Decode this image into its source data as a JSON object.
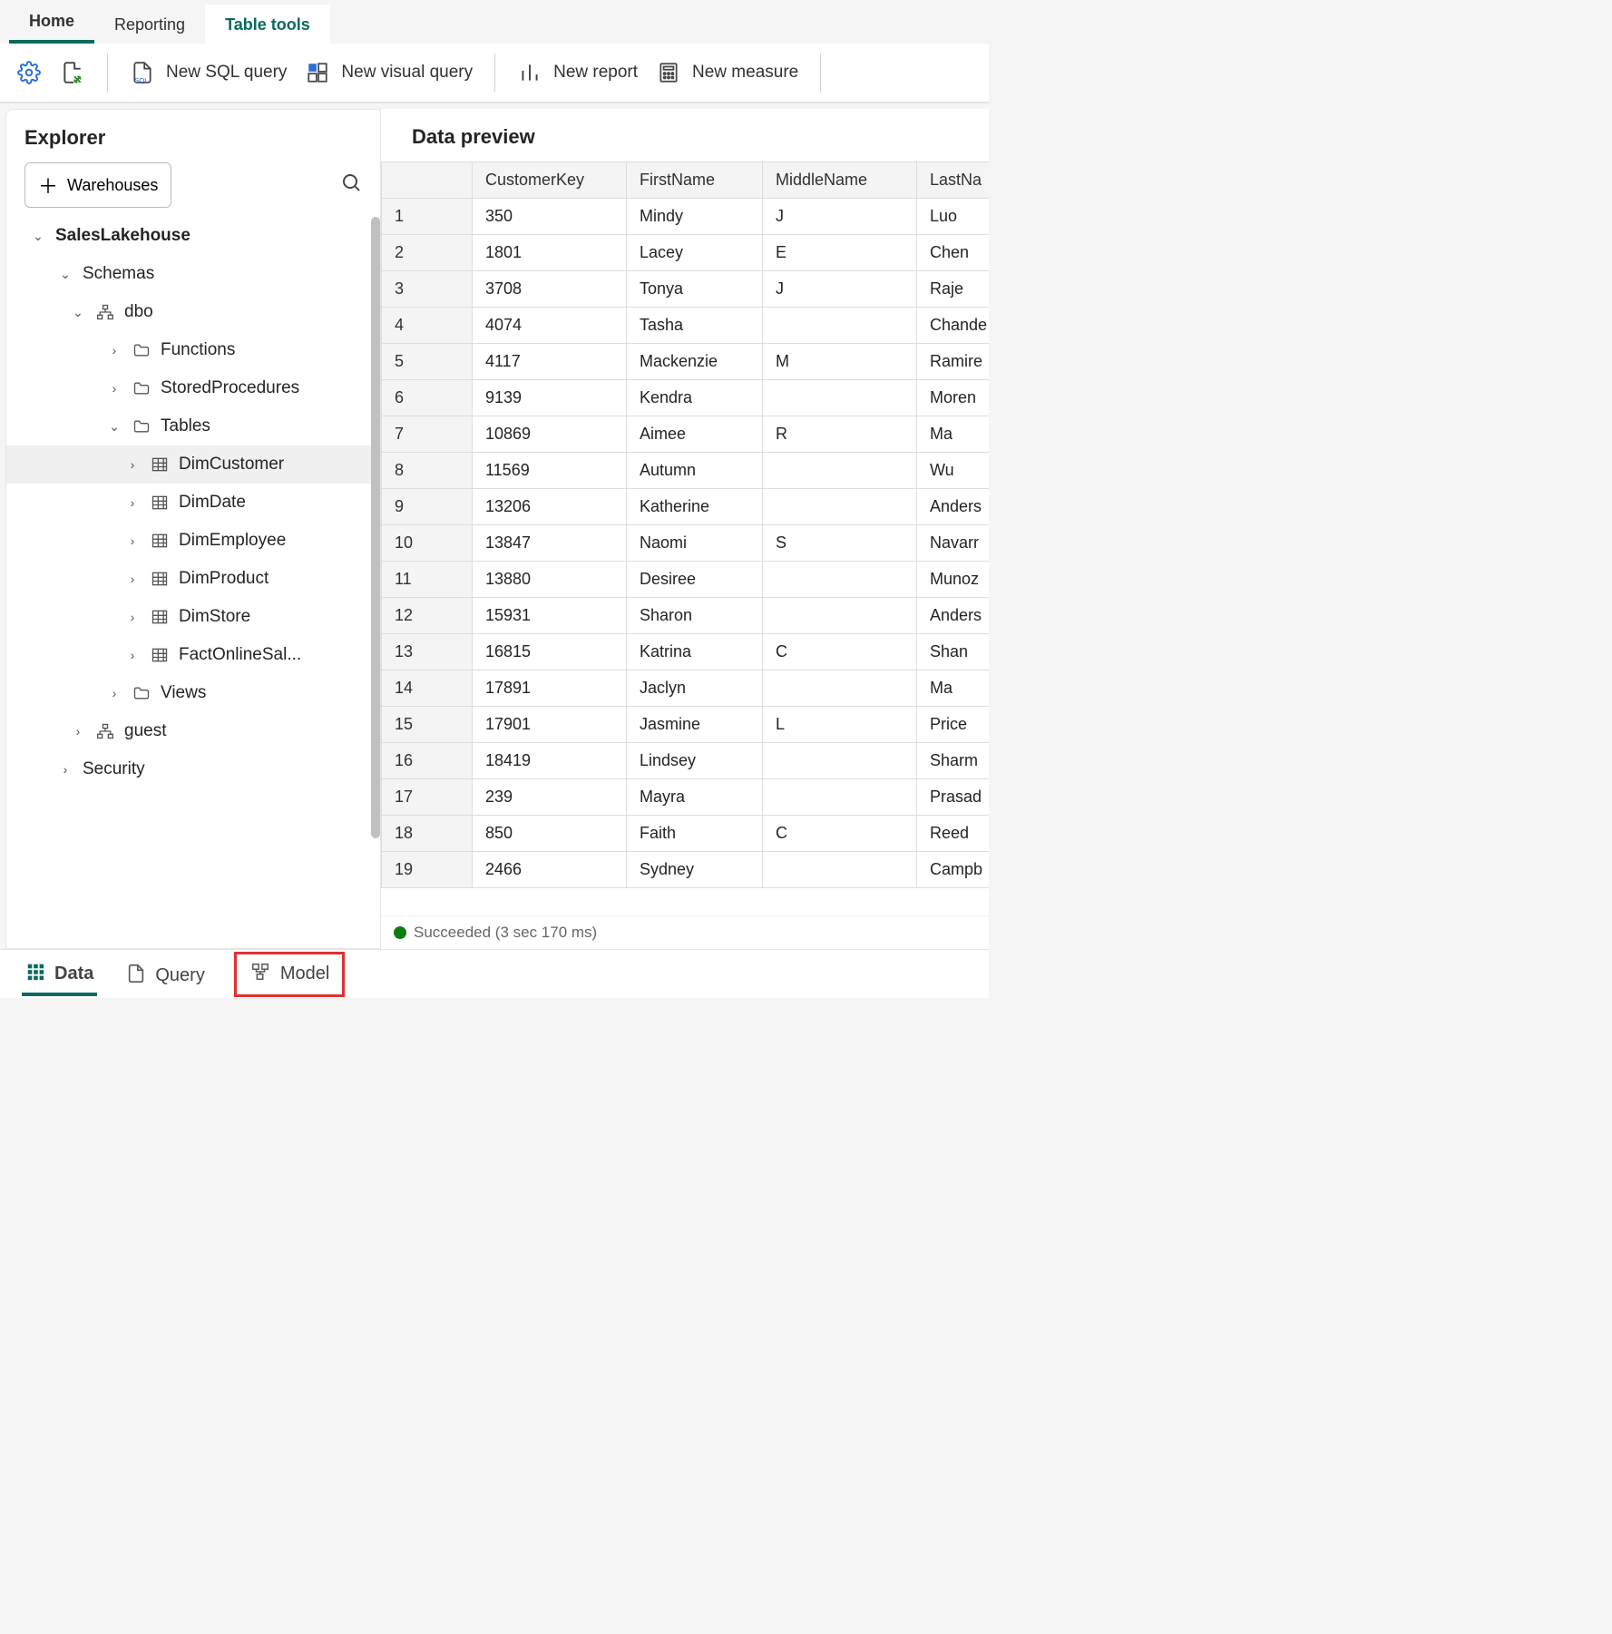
{
  "ribbon": {
    "tabs": [
      "Home",
      "Reporting",
      "Table tools"
    ],
    "active": 0,
    "highlighted": 2
  },
  "toolbar": {
    "new_sql_query": "New SQL query",
    "new_visual_query": "New visual query",
    "new_report": "New report",
    "new_measure": "New measure"
  },
  "explorer": {
    "title": "Explorer",
    "warehouses_btn": "Warehouses",
    "tree": {
      "root": "SalesLakehouse",
      "schemas_label": "Schemas",
      "dbo_label": "dbo",
      "functions": "Functions",
      "storedprocs": "StoredProcedures",
      "tables_label": "Tables",
      "tables": [
        "DimCustomer",
        "DimDate",
        "DimEmployee",
        "DimProduct",
        "DimStore",
        "FactOnlineSal..."
      ],
      "selected_table_index": 0,
      "views": "Views",
      "guest": "guest",
      "security": "Security"
    }
  },
  "preview": {
    "title": "Data preview",
    "columns": [
      "CustomerKey",
      "FirstName",
      "MiddleName",
      "LastNa"
    ],
    "rows": [
      [
        "350",
        "Mindy",
        "J",
        "Luo"
      ],
      [
        "1801",
        "Lacey",
        "E",
        "Chen"
      ],
      [
        "3708",
        "Tonya",
        "J",
        "Raje"
      ],
      [
        "4074",
        "Tasha",
        "",
        "Chande"
      ],
      [
        "4117",
        "Mackenzie",
        "M",
        "Ramire"
      ],
      [
        "9139",
        "Kendra",
        "",
        "Moren"
      ],
      [
        "10869",
        "Aimee",
        "R",
        "Ma"
      ],
      [
        "11569",
        "Autumn",
        "",
        "Wu"
      ],
      [
        "13206",
        "Katherine",
        "",
        "Anders"
      ],
      [
        "13847",
        "Naomi",
        "S",
        "Navarr"
      ],
      [
        "13880",
        "Desiree",
        "",
        "Munoz"
      ],
      [
        "15931",
        "Sharon",
        "",
        "Anders"
      ],
      [
        "16815",
        "Katrina",
        "C",
        "Shan"
      ],
      [
        "17891",
        "Jaclyn",
        "",
        "Ma"
      ],
      [
        "17901",
        "Jasmine",
        "L",
        "Price"
      ],
      [
        "18419",
        "Lindsey",
        "",
        "Sharm"
      ],
      [
        "239",
        "Mayra",
        "",
        "Prasad"
      ],
      [
        "850",
        "Faith",
        "C",
        "Reed"
      ],
      [
        "2466",
        "Sydney",
        "",
        "Campb"
      ]
    ],
    "status": "Succeeded (3 sec 170 ms)"
  },
  "bottom_tabs": {
    "data": "Data",
    "query": "Query",
    "model": "Model"
  }
}
